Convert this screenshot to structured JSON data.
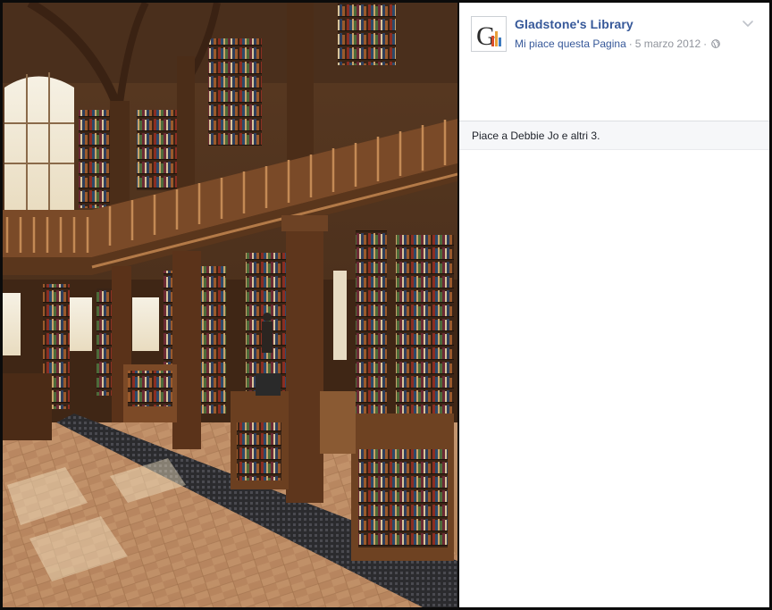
{
  "post": {
    "page_name": "Gladstone's Library",
    "like_page_link": "Mi piace questa Pagina",
    "separator": "·",
    "date": "5 marzo 2012",
    "audience_icon": "globe-icon",
    "options_icon": "chevron-down-icon",
    "avatar_letter": "G"
  },
  "reactions": {
    "summary": "Piace a Debbie Jo e altri 3."
  },
  "photo": {
    "description_icon": "library-photo"
  },
  "colors": {
    "link": "#365899",
    "meta": "#90949c",
    "likes_bg": "#f6f7f9"
  }
}
